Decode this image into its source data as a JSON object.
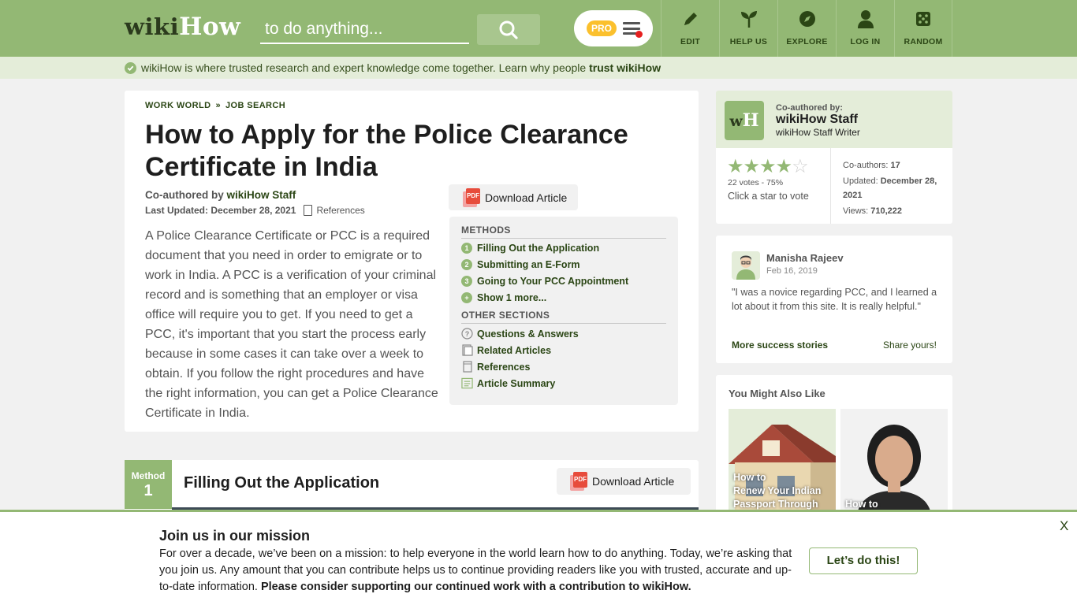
{
  "header": {
    "logo_wiki": "wiki",
    "logo_how": "How",
    "search_placeholder": "to do anything...",
    "pro_label": "PRO",
    "nav": [
      {
        "label": "EDIT",
        "icon": "pencil-icon"
      },
      {
        "label": "HELP US",
        "icon": "sprout-icon"
      },
      {
        "label": "EXPLORE",
        "icon": "compass-icon"
      },
      {
        "label": "LOG IN",
        "icon": "user-icon"
      },
      {
        "label": "RANDOM",
        "icon": "dice-icon"
      }
    ]
  },
  "trustbar": {
    "text": "wikiHow is where trusted research and expert knowledge come together. Learn why people ",
    "link": "trust wikiHow"
  },
  "article": {
    "breadcrumb": [
      "WORK WORLD",
      "JOB SEARCH"
    ],
    "breadcrumb_sep": "»",
    "title": "How to Apply for the Police Clearance Certificate in India",
    "coauthored_prefix": "Co-authored by ",
    "coauthored_name": "wikiHow Staff",
    "last_updated_label": "Last Updated:",
    "last_updated_date": "December 28, 2021",
    "references_label": "References",
    "download_label": "Download Article",
    "intro": "A Police Clearance Certificate or PCC is a required document that you need in order to emigrate or to work in India. A PCC is a verification of your criminal record and is something that an employer or visa office will require you to get. If you need to get a PCC, it's important that you start the process early because in some cases it can take over a week to obtain. If you follow the right procedures and have the right information, you can get a Police Clearance Certificate in India."
  },
  "toc": {
    "methods_heading": "METHODS",
    "methods": [
      {
        "num": "1",
        "label": "Filling Out the Application"
      },
      {
        "num": "2",
        "label": "Submitting an E-Form"
      },
      {
        "num": "3",
        "label": "Going to Your PCC Appointment"
      },
      {
        "num": "+",
        "label": "Show 1 more..."
      }
    ],
    "other_heading": "OTHER SECTIONS",
    "other": [
      {
        "label": "Questions & Answers",
        "icon": "question-icon"
      },
      {
        "label": "Related Articles",
        "icon": "related-icon"
      },
      {
        "label": "References",
        "icon": "document-icon"
      },
      {
        "label": "Article Summary",
        "icon": "summary-icon"
      }
    ]
  },
  "method": {
    "tab_label": "Method",
    "tab_num": "1",
    "title": "Filling Out the Application",
    "download_label": "Download Article"
  },
  "author": {
    "logo_w": "w",
    "logo_h": "H",
    "coauthored_by": "Co-authored by:",
    "name": "wikiHow Staff",
    "role": "wikiHow Staff Writer",
    "rating": 0.75,
    "votes": "22 votes - 75%",
    "click_star": "Click a star to vote",
    "coauthors_label": "Co-authors:",
    "coauthors_value": "17",
    "updated_label": "Updated:",
    "updated_value": "December 28, 2021",
    "views_label": "Views:",
    "views_value": "710,222"
  },
  "review": {
    "name": "Manisha Rajeev",
    "date": "Feb 16, 2019",
    "text": "\"I was a novice regarding PCC, and I learned a lot about it from this site. It is really helpful.\"",
    "more_link": "More success stories",
    "share_link": "Share yours!"
  },
  "also_like": {
    "heading": "You Might Also Like",
    "items": [
      {
        "line1": "How to",
        "line2": "Renew Your Indian",
        "line3": "Passport Through"
      },
      {
        "line1": "How to"
      }
    ]
  },
  "banner": {
    "title": "Join us in our mission",
    "text": "For over a decade, we’ve been on a mission: to help everyone in the world learn how to do anything. Today, we’re asking that you join us. Any amount that you can contribute helps us to continue providing readers like you with trusted, accurate and up-to-date information. ",
    "text_bold": "Please consider supporting our continued work with a contribution to wikiHow.",
    "button": "Let’s do this!",
    "close": "X"
  },
  "colors": {
    "brand_green": "#93b874",
    "dark_green": "#2b4615",
    "light_green": "#e4edd9",
    "pro_yellow": "#fbc02d",
    "pdf_red": "#e74c3c"
  }
}
